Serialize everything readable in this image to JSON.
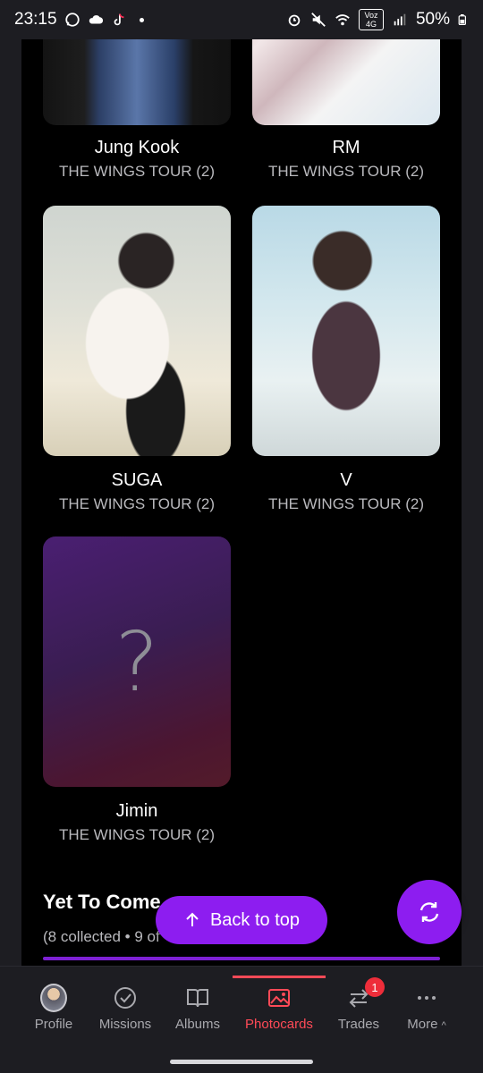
{
  "status_bar": {
    "time": "23:15",
    "battery": "50%",
    "network": "Voz 4G"
  },
  "cards": [
    {
      "name": "Jung Kook",
      "album": "THE WINGS TOUR (2)"
    },
    {
      "name": "RM",
      "album": "THE WINGS TOUR (2)"
    },
    {
      "name": "SUGA",
      "album": "THE WINGS TOUR (2)"
    },
    {
      "name": "V",
      "album": "THE WINGS TOUR (2)"
    },
    {
      "name": "Jimin",
      "album": "THE WINGS TOUR (2)",
      "placeholder": "?"
    }
  ],
  "section": {
    "title": "Yet To Come",
    "stats": "(8 collected • 9 of"
  },
  "back_to_top": "Back to top",
  "nav": {
    "items": [
      {
        "label": "Profile",
        "icon": "avatar"
      },
      {
        "label": "Missions",
        "icon": "check-circle-icon"
      },
      {
        "label": "Albums",
        "icon": "book-icon"
      },
      {
        "label": "Photocards",
        "icon": "image-icon"
      },
      {
        "label": "Trades",
        "icon": "swap-icon"
      },
      {
        "label": "More",
        "icon": "more-icon"
      }
    ],
    "active": "Photocards",
    "trades_badge": "1"
  },
  "colors": {
    "accent": "#8d1df0",
    "active": "#ff4a57",
    "background": "#000000"
  }
}
